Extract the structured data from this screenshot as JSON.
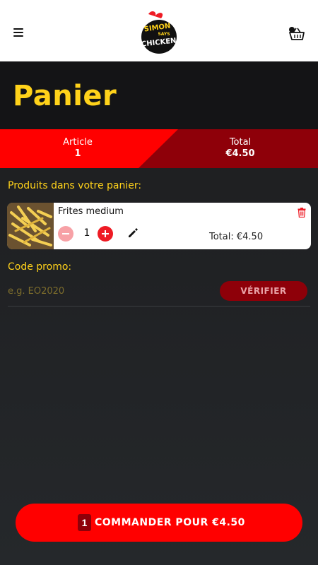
{
  "header": {
    "menu_icon": "hamburger-menu-icon",
    "logo_text": [
      "SIMON",
      "SAYS",
      "CHICKEN"
    ],
    "cart_icon": "basket-icon",
    "cart_badge_color": "#111111"
  },
  "page": {
    "title": "Panier",
    "title_color": "#ffd21a"
  },
  "summary": {
    "article_label": "Article",
    "article_value": "1",
    "total_label": "Total",
    "total_value": "€4.50",
    "left_color": "#ff0000",
    "right_color": "#8e0009"
  },
  "cart": {
    "heading": "Produits dans votre panier:",
    "items": [
      {
        "name": "Frites medium",
        "quantity": "1",
        "total": "Total: €4.50",
        "image": "fries-photo",
        "minus_icon": "minus-icon",
        "plus_icon": "plus-icon",
        "edit_icon": "pencil-icon",
        "delete_icon": "trash-icon"
      }
    ]
  },
  "promo": {
    "label": "Code promo:",
    "placeholder": "e.g. EO2020",
    "verify_label": "VÉRIFIER"
  },
  "order": {
    "count": "1",
    "label": "COMMANDER POUR €4.50",
    "button_color": "#ff0000"
  }
}
